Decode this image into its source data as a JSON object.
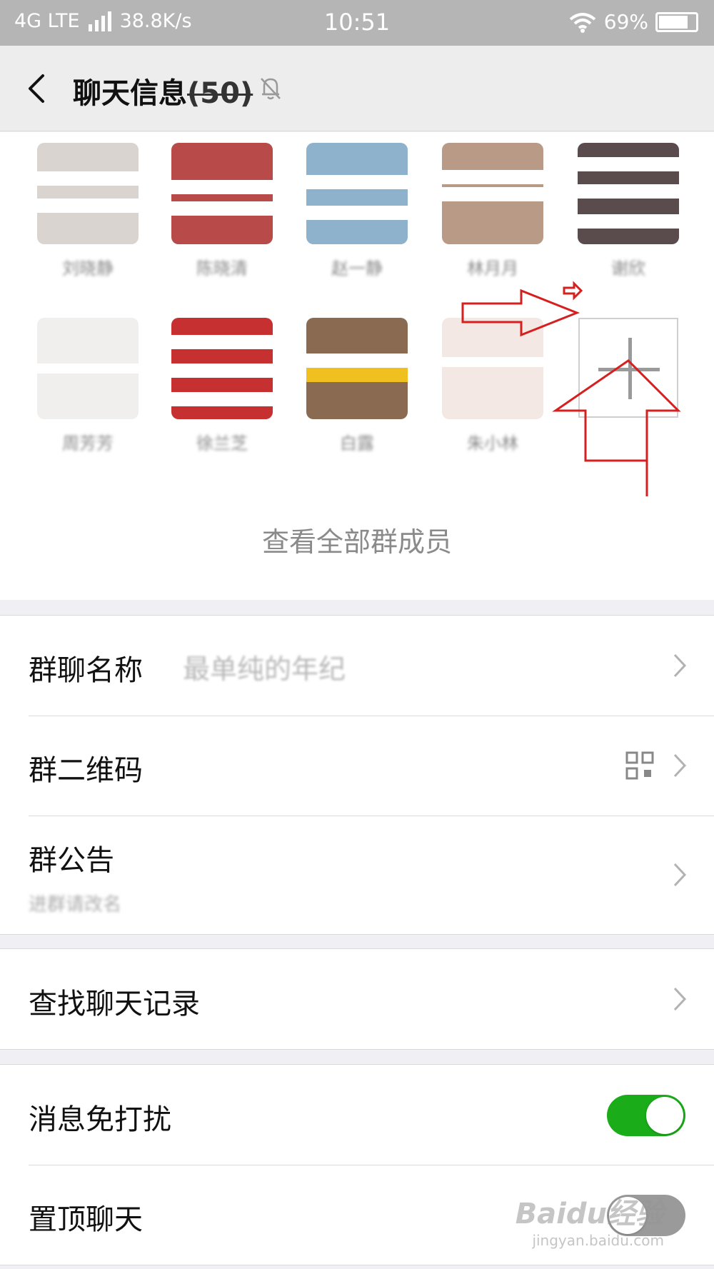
{
  "status_bar": {
    "network": "4G LTE",
    "speed": "38.8K/s",
    "time": "10:51",
    "battery": "69%",
    "icons": [
      "signal-icon",
      "wifi-icon",
      "battery-icon"
    ]
  },
  "title_bar": {
    "title": "聊天信息",
    "member_count": "(50)",
    "icons": [
      "back-icon",
      "mute-bell-icon"
    ]
  },
  "members": {
    "items": [
      {
        "name": "刘晓静",
        "avatar_color": "#d9d4cf"
      },
      {
        "name": "陈晓清",
        "avatar_color": "#b84a4a"
      },
      {
        "name": "赵一静",
        "avatar_color": "#8eb1cc"
      },
      {
        "name": "林月月",
        "avatar_color": "#b89a86"
      },
      {
        "name": "谢欣",
        "avatar_color": "#5a4b4d"
      },
      {
        "name": "周芳芳",
        "avatar_color": "#f1efed"
      },
      {
        "name": "徐兰芝",
        "avatar_color": "#c63030"
      },
      {
        "name": "白露",
        "avatar_color": "#8a6a50"
      },
      {
        "name": "朱小林",
        "avatar_color": "#f3e8e4"
      }
    ],
    "add_icon": "plus-icon",
    "view_all": "查看全部群成员"
  },
  "settings": {
    "group_name": {
      "label": "群聊名称",
      "value": "最单纯的年纪"
    },
    "qr_code": {
      "label": "群二维码"
    },
    "announcement": {
      "label": "群公告",
      "preview": "进群请改名"
    },
    "search_history": {
      "label": "查找聊天记录"
    },
    "mute": {
      "label": "消息免打扰",
      "state": "on"
    },
    "pin": {
      "label": "置顶聊天",
      "state": "off"
    }
  },
  "colors": {
    "accent_green": "#1aad19",
    "annotation_red": "#d62020",
    "toggle_off": "#9a9a9a"
  },
  "watermark": {
    "brand": "Baidu经验",
    "url": "jingyan.baidu.com"
  }
}
